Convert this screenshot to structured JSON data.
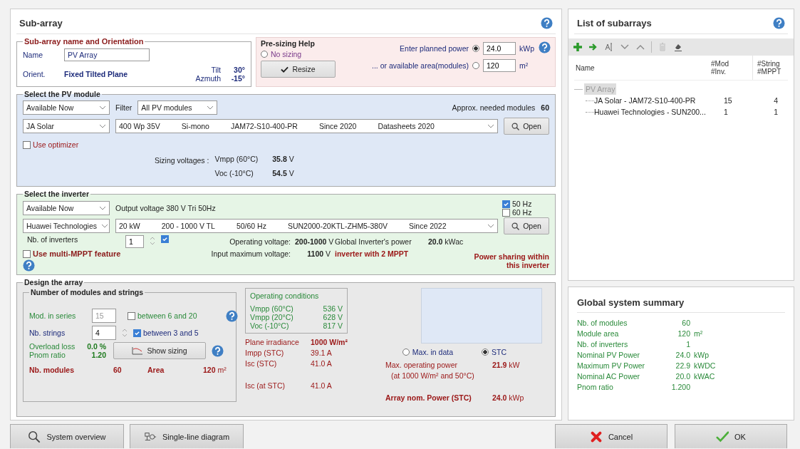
{
  "dialog": {
    "title": "Sub-array"
  },
  "name_orientation": {
    "legend": "Sub-array name and Orientation",
    "name_label": "Name",
    "name_value": "PV Array",
    "orient_label": "Orient.",
    "orient_value": "Fixed Tilted Plane",
    "tilt_label": "Tilt",
    "tilt_value": "30°",
    "azimuth_label": "Azmuth",
    "azimuth_value": "-15°"
  },
  "presizing": {
    "legend": "Pre-sizing Help",
    "resize_button": "Resize",
    "options": [
      {
        "label": "No sizing",
        "selected": false
      },
      {
        "label": "Enter planned power",
        "selected": true,
        "value": "24.0",
        "unit": "kWp"
      },
      {
        "label": "... or available area(modules)",
        "selected": false,
        "value": "120",
        "unit": "m²"
      }
    ]
  },
  "pv_module": {
    "legend": "Select the PV module",
    "availability": "Available Now",
    "filter_label": "Filter",
    "filter": "All PV modules",
    "approx_label": "Approx. needed modules",
    "approx_value": "60",
    "manufacturer": "JA Solar",
    "model_fields": [
      "400 Wp 35V",
      "Si-mono",
      "JAM72-S10-400-PR",
      "Since 2020",
      "Datasheets 2020"
    ],
    "open_button": "Open",
    "optimizer": {
      "label": "Use optimizer",
      "checked": false
    },
    "sizing_label": "Sizing voltages :",
    "voltages": [
      {
        "label": "Vmpp (60°C)",
        "value": "35.8",
        "unit": "V"
      },
      {
        "label": "Voc (-10°C)",
        "value": "54.5",
        "unit": "V"
      }
    ]
  },
  "inverter": {
    "legend": "Select the inverter",
    "availability": "Available Now",
    "output_voltage": "Output voltage 380 V Tri 50Hz",
    "frequencies": [
      {
        "label": "50 Hz",
        "checked": true
      },
      {
        "label": "60 Hz",
        "checked": false
      }
    ],
    "manufacturer": "Huawei Technologies",
    "model_fields": [
      "20 kW",
      "200 - 1000 V  TL",
      "50/60 Hz",
      "SUN2000-20KTL-ZHM5-380V",
      "Since 2022"
    ],
    "open_button": "Open",
    "count_label": "Nb. of inverters",
    "count_value": "1",
    "count_checked": true,
    "operating_label": "Operating voltage:",
    "operating_value": "200-1000",
    "operating_unit": "V",
    "global_label": "Global Inverter's power",
    "global_value": "20.0",
    "global_unit": "kWac",
    "input_max_label": "Input maximum voltage:",
    "input_max_value": "1100",
    "input_max_unit": "V",
    "mppt_note": "inverter with 2 MPPT",
    "multi_mppt": {
      "label": "Use multi-MPPT feature",
      "checked": false
    },
    "power_sharing": "Power sharing within this inverter"
  },
  "design": {
    "legend": "Design the array",
    "sub_legend": "Number of modules and strings",
    "series": {
      "label": "Mod. in series",
      "value": "15",
      "range": "between 6 and 20",
      "checked": false
    },
    "strings": {
      "label": "Nb. strings",
      "value": "4",
      "range": "between 3 and 5",
      "checked": true
    },
    "overload_label": "Overload loss",
    "overload_value": "0.0 %",
    "pnom_label": "Pnom ratio",
    "pnom_value": "1.20",
    "show_sizing": "Show sizing",
    "modules_label": "Nb. modules",
    "modules_value": "60",
    "area_label": "Area",
    "area_value": "120",
    "area_unit": "m²",
    "conditions_title": "Operating conditions",
    "conditions": [
      {
        "label": "Vmpp (60°C)",
        "value": "536",
        "unit": "V"
      },
      {
        "label": "Vmpp (20°C)",
        "value": "628",
        "unit": "V"
      },
      {
        "label": "Voc (-10°C)",
        "value": "817",
        "unit": "V"
      }
    ],
    "irradiance_label": "Plane irradiance",
    "irradiance_value": "1000 W/m²",
    "currents": [
      {
        "label": "Impp (STC)",
        "value": "39.1 A"
      },
      {
        "label": "Isc (STC)",
        "value": "41.0 A"
      }
    ],
    "isc_label": "Isc (at STC)",
    "isc_value": "41.0 A",
    "modes": [
      {
        "label": "Max. in data",
        "selected": false
      },
      {
        "label": "STC",
        "selected": true
      }
    ],
    "max_power_label": "Max. operating power",
    "max_power_note": "(at 1000 W/m²  and 50°C)",
    "max_power_value": "21.9",
    "max_power_unit": "kW",
    "nom_power_label": "Array nom. Power (STC)",
    "nom_power_value": "24.0",
    "nom_power_unit": "kWp"
  },
  "subarray_list": {
    "title": "List of subarrays",
    "columns": [
      [
        "Name"
      ],
      [
        "#Mod",
        "#Inv."
      ],
      [
        "#String",
        "#MPPT"
      ]
    ],
    "tree": [
      {
        "name": "PV Array",
        "selected": true,
        "children": [
          {
            "name": "JA Solar - JAM72-S10-400-PR",
            "col_2": "15",
            "col_3": "4"
          },
          {
            "name": "Huawei Technologies - SUN200...",
            "col_2": "1",
            "col_3": "1"
          }
        ]
      }
    ]
  },
  "summary": {
    "title": "Global system summary",
    "rows": [
      {
        "label": "Nb. of modules",
        "value": "60",
        "unit": ""
      },
      {
        "label": "Module area",
        "value": "120",
        "unit": "m²"
      },
      {
        "label": "Nb. of inverters",
        "value": "1",
        "unit": ""
      },
      {
        "label": "Nominal PV Power",
        "value": "24.0",
        "unit": "kWp"
      },
      {
        "label": "Maximum PV Power",
        "value": "22.9",
        "unit": "kWDC"
      },
      {
        "label": "Nominal AC Power",
        "value": "20.0",
        "unit": "kWAC"
      },
      {
        "label": "Pnom ratio",
        "value": "1.200",
        "unit": ""
      }
    ]
  },
  "buttons": [
    {
      "kind": "overview",
      "label": "System overview"
    },
    {
      "kind": "diagram",
      "label": "Single-line diagram"
    },
    {
      "kind": "cancel",
      "label": "Cancel"
    },
    {
      "kind": "ok",
      "label": "OK"
    }
  ]
}
